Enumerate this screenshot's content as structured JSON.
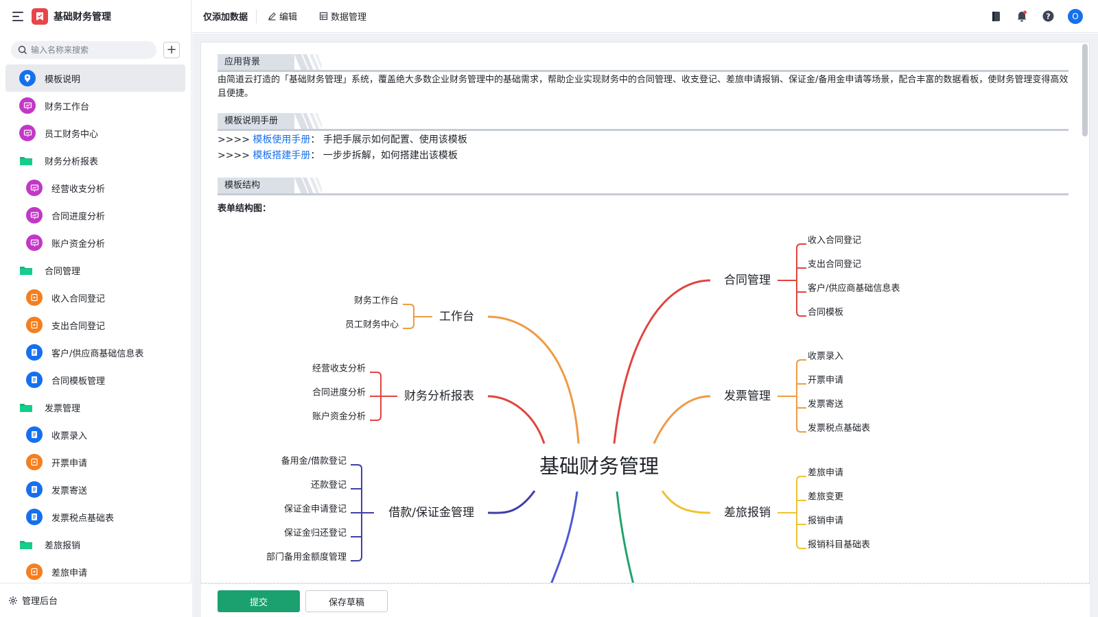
{
  "app": {
    "title": "基础财务管理",
    "search_placeholder": "输入名称来搜索",
    "footer_label": "管理后台"
  },
  "sidebar": {
    "items": [
      {
        "label": "模板说明",
        "type": "doc",
        "color": "#1570ef",
        "active": true,
        "child": false
      },
      {
        "label": "财务工作台",
        "type": "dash",
        "color": "#c238c6",
        "child": false
      },
      {
        "label": "员工财务中心",
        "type": "dash",
        "color": "#c238c6",
        "child": false
      },
      {
        "label": "财务分析报表",
        "type": "folder",
        "color": "#19b37c",
        "child": false
      },
      {
        "label": "经营收支分析",
        "type": "dash",
        "color": "#c238c6",
        "child": true
      },
      {
        "label": "合同进度分析",
        "type": "dash",
        "color": "#c238c6",
        "child": true
      },
      {
        "label": "账户资金分析",
        "type": "dash",
        "color": "#c238c6",
        "child": true
      },
      {
        "label": "合同管理",
        "type": "folder",
        "color": "#19b37c",
        "child": false
      },
      {
        "label": "收入合同登记",
        "type": "flow",
        "color": "#f57e1f",
        "child": true
      },
      {
        "label": "支出合同登记",
        "type": "flow",
        "color": "#f57e1f",
        "child": true
      },
      {
        "label": "客户/供应商基础信息表",
        "type": "form",
        "color": "#1570ef",
        "child": true
      },
      {
        "label": "合同模板管理",
        "type": "form",
        "color": "#1570ef",
        "child": true
      },
      {
        "label": "发票管理",
        "type": "folder",
        "color": "#19b37c",
        "child": false
      },
      {
        "label": "收票录入",
        "type": "form",
        "color": "#1570ef",
        "child": true
      },
      {
        "label": "开票申请",
        "type": "flow",
        "color": "#f57e1f",
        "child": true
      },
      {
        "label": "发票寄送",
        "type": "form",
        "color": "#1570ef",
        "child": true
      },
      {
        "label": "发票税点基础表",
        "type": "form",
        "color": "#1570ef",
        "child": true
      },
      {
        "label": "差旅报销",
        "type": "folder",
        "color": "#19b37c",
        "child": false
      },
      {
        "label": "差旅申请",
        "type": "flow",
        "color": "#f57e1f",
        "child": true
      }
    ]
  },
  "topbar": {
    "add_data": "仅添加数据",
    "edit": "编辑",
    "data_manage": "数据管理",
    "avatar_letter": "O"
  },
  "content": {
    "bg_title": "应用背景",
    "bg_text": "由简道云打造的「基础财务管理」系统，覆盖绝大多数企业财务管理中的基础需求，帮助企业实现财务中的合同管理、收支登记、差旅申请报销、保证金/备用金申请等场景，配合丰富的数据看板，使财务管理变得高效且便捷。",
    "manual_title": "模板说明手册",
    "manual_prefix": ">>>>",
    "manual_links": [
      {
        "link": "模板使用手册",
        "desc": "：  手把手展示如何配置、使用该模板"
      },
      {
        "link": "模板搭建手册",
        "desc": "：  一步步拆解，如何搭建出该模板"
      }
    ],
    "struct_title": "模板结构",
    "struct_label": "表单结构图："
  },
  "mindmap": {
    "center": "基础财务管理",
    "branches": [
      {
        "name": "工作台",
        "color": "#ef9a44",
        "items": [
          "财务工作台",
          "员工财务中心"
        ]
      },
      {
        "name": "财务分析报表",
        "color": "#e0443e",
        "items": [
          "经营收支分析",
          "合同进度分析",
          "账户资金分析"
        ]
      },
      {
        "name": "借款/保证金管理",
        "color": "#3f3fa8",
        "items": [
          "备用金/借款登记",
          "还款登记",
          "保证金申请登记",
          "保证金归还登记",
          "部门备用金额度管理"
        ]
      },
      {
        "name": "合同管理",
        "color": "#e0443e",
        "items": [
          "收入合同登记",
          "支出合同登记",
          "客户/供应商基础信息表",
          "合同模板"
        ]
      },
      {
        "name": "发票管理",
        "color": "#ef9a44",
        "items": [
          "收票录入",
          "开票申请",
          "发票寄送",
          "发票税点基础表"
        ]
      },
      {
        "name": "差旅报销",
        "color": "#eec32f",
        "items": [
          "差旅申请",
          "差旅变更",
          "报销申请",
          "报销科目基础表"
        ]
      }
    ],
    "extra_colors": {
      "blue": "#4a58d6",
      "green": "#1ea36b"
    }
  },
  "actions": {
    "submit": "提交",
    "draft": "保存草稿"
  }
}
